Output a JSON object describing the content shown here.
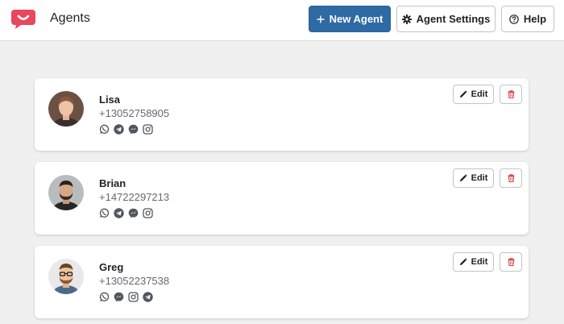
{
  "header": {
    "title": "Agents",
    "new_agent_label": "New Agent",
    "settings_label": "Agent Settings",
    "help_label": "Help"
  },
  "colors": {
    "brand": "#e8475d",
    "primary": "#2e6ba4",
    "delete": "#d63638"
  },
  "agents": [
    {
      "name": "Lisa",
      "phone": "+13052758905",
      "channels": [
        "whatsapp-icon",
        "telegram-icon",
        "messenger-icon",
        "instagram-icon"
      ],
      "edit_label": "Edit"
    },
    {
      "name": "Brian",
      "phone": "+14722297213",
      "channels": [
        "whatsapp-icon",
        "telegram-icon",
        "messenger-icon",
        "instagram-icon"
      ],
      "edit_label": "Edit"
    },
    {
      "name": "Greg",
      "phone": "+13052237538",
      "channels": [
        "whatsapp-icon",
        "messenger-icon",
        "instagram-icon",
        "telegram-icon"
      ],
      "edit_label": "Edit"
    }
  ]
}
